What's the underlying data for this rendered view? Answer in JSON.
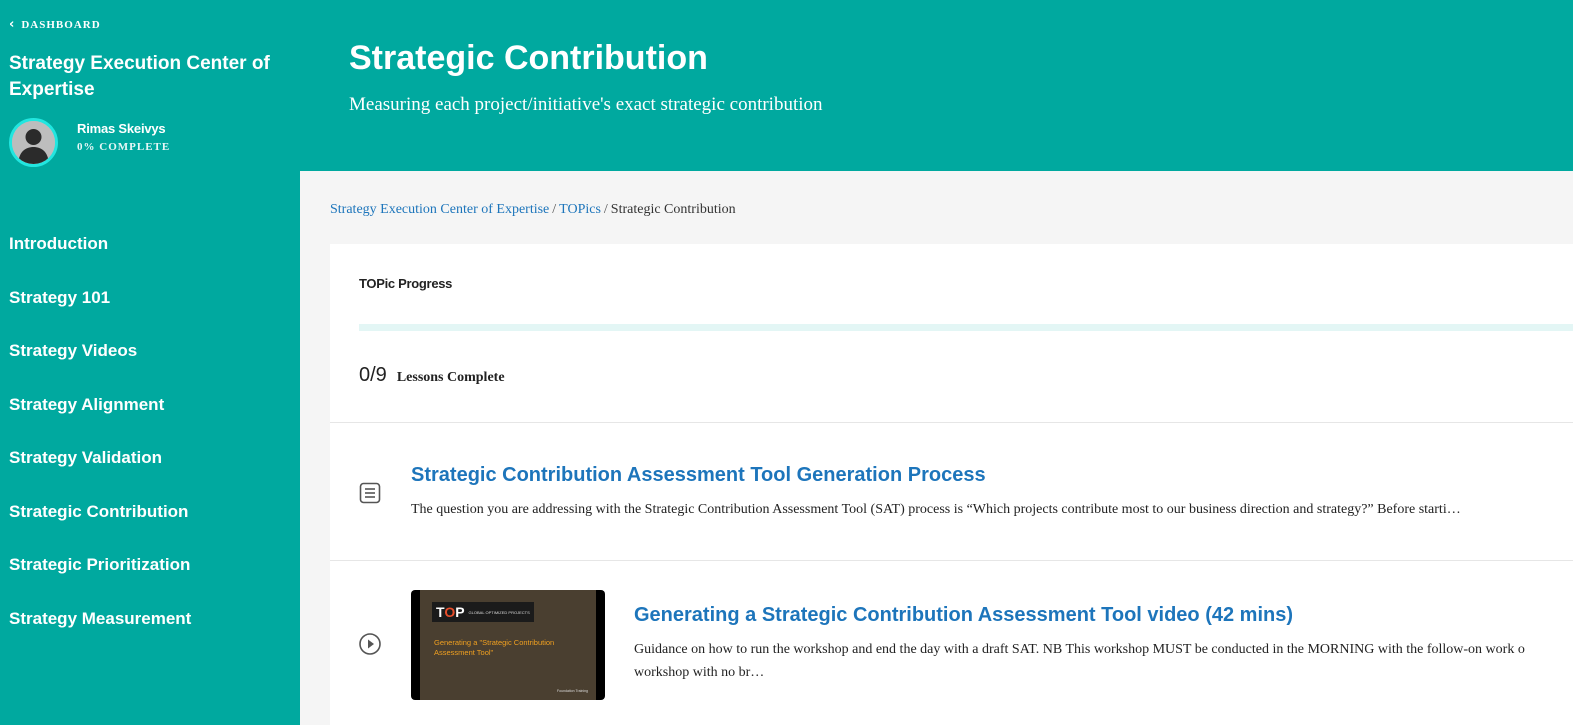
{
  "sidebar": {
    "back_label": "DASHBOARD",
    "course_title": "Strategy Execution Center of Expertise",
    "user_name": "Rimas Skeivys",
    "user_progress": "0% COMPLETE",
    "nav_items": [
      "Introduction",
      "Strategy 101",
      "Strategy Videos",
      "Strategy Alignment",
      "Strategy Validation",
      "Strategic Contribution",
      "Strategic Prioritization",
      "Strategy Measurement"
    ]
  },
  "header": {
    "title": "Strategic Contribution",
    "subtitle": "Measuring each project/initiative's exact strategic contribution"
  },
  "breadcrumb": {
    "items": [
      "Strategy Execution Center of Expertise",
      "TOPics",
      "Strategic Contribution"
    ],
    "separator": "/"
  },
  "progress": {
    "label": "TOPic Progress",
    "completed": 0,
    "total": 9,
    "count_text": "0/9",
    "count_label": "Lessons Complete"
  },
  "lessons": [
    {
      "type_icon": "document-icon",
      "title": "Strategic Contribution Assessment Tool Generation Process",
      "excerpt": "The question you are addressing with the Strategic Contribution Assessment Tool (SAT) process is “Which projects contribute most to our business direction and strategy?” Before starti…"
    },
    {
      "type_icon": "play-circle-icon",
      "title": "Generating a Strategic Contribution Assessment Tool video (42 mins)",
      "excerpt_line1": "Guidance on how to run the workshop and end the day with a draft SAT. NB This workshop MUST be conducted in the MORNING with the follow-on work o",
      "excerpt_line2": "workshop with no br…",
      "thumbnail": {
        "logo_letters_t": "T",
        "logo_letters_o": "O",
        "logo_letters_p": "P",
        "logo_small": "GLOBAL OPTIMIZED PROJECTS",
        "text": "Generating a \"Strategic Contribution Assessment Tool\"",
        "footer": "Foundation Training"
      }
    }
  ],
  "colors": {
    "brand": "#00a99f",
    "link": "#1d75bb",
    "avatar_ring": "#22e6e0"
  }
}
